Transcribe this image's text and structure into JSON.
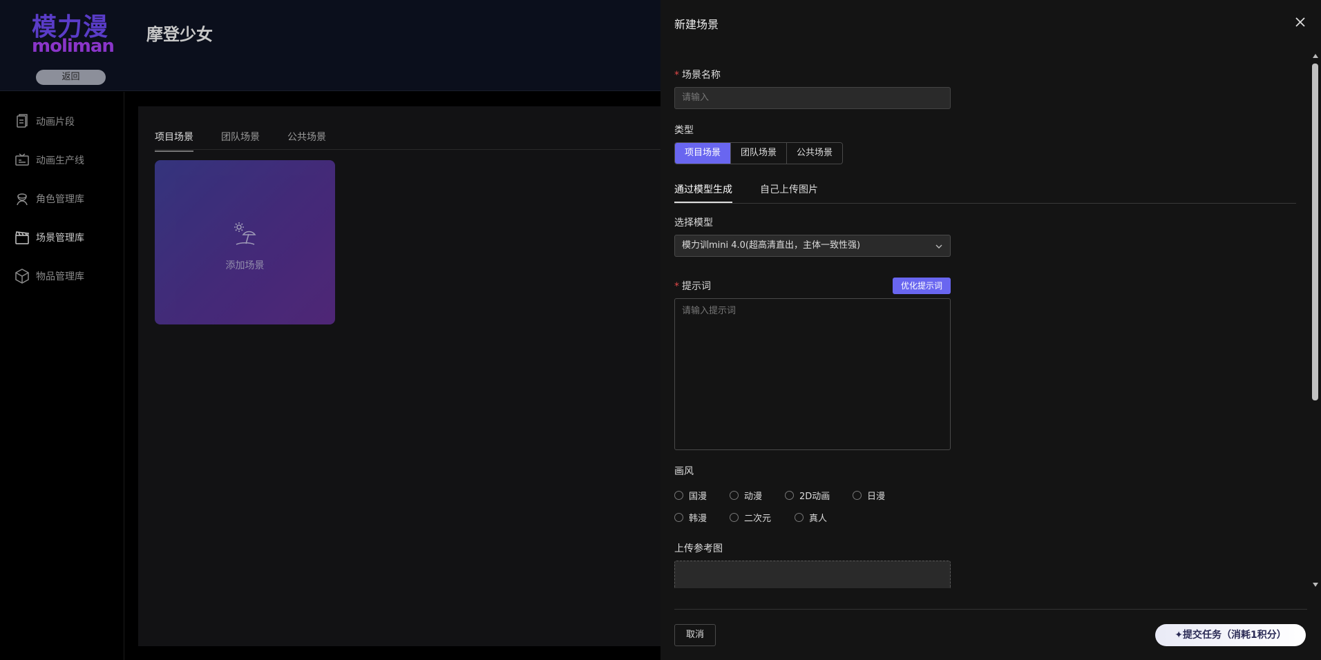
{
  "app": {
    "logo_cn": "模力漫",
    "logo_en": "moliman",
    "back_label": "返回",
    "project_title": "摩登少女"
  },
  "sidebar": {
    "items": [
      {
        "label": "动画片段",
        "icon": "file-icon"
      },
      {
        "label": "动画生产线",
        "icon": "tv-icon"
      },
      {
        "label": "角色管理库",
        "icon": "character-icon"
      },
      {
        "label": "场景管理库",
        "icon": "clapperboard-icon"
      },
      {
        "label": "物品管理库",
        "icon": "box-icon"
      }
    ],
    "active": "场景管理库"
  },
  "content": {
    "tabs": [
      "项目场景",
      "团队场景",
      "公共场景"
    ],
    "active_tab": "项目场景",
    "add_card_label": "添加场景"
  },
  "drawer": {
    "title": "新建场景",
    "scene_name": {
      "label": "场景名称",
      "placeholder": "请输入"
    },
    "type": {
      "label": "类型",
      "options": [
        "项目场景",
        "团队场景",
        "公共场景"
      ],
      "selected": "项目场景"
    },
    "gen_tabs": [
      "通过模型生成",
      "自己上传图片"
    ],
    "gen_tab_active": "通过模型生成",
    "model": {
      "label": "选择模型",
      "value": "模力训mini 4.0(超高清直出，主体一致性强)"
    },
    "prompt": {
      "label": "提示词",
      "optimize_label": "优化提示词",
      "placeholder": "请输入提示词"
    },
    "style": {
      "label": "画风",
      "row1": [
        "国漫",
        "动漫",
        "2D动画",
        "日漫"
      ],
      "row2": [
        "韩漫",
        "二次元",
        "真人"
      ]
    },
    "upload": {
      "label": "上传参考图"
    },
    "cancel_label": "取消",
    "submit_label": "✦提交任务（消耗1积分）"
  },
  "colors": {
    "accent": "#6966f0",
    "required": "#e04848",
    "drawer_bg": "#141414"
  }
}
